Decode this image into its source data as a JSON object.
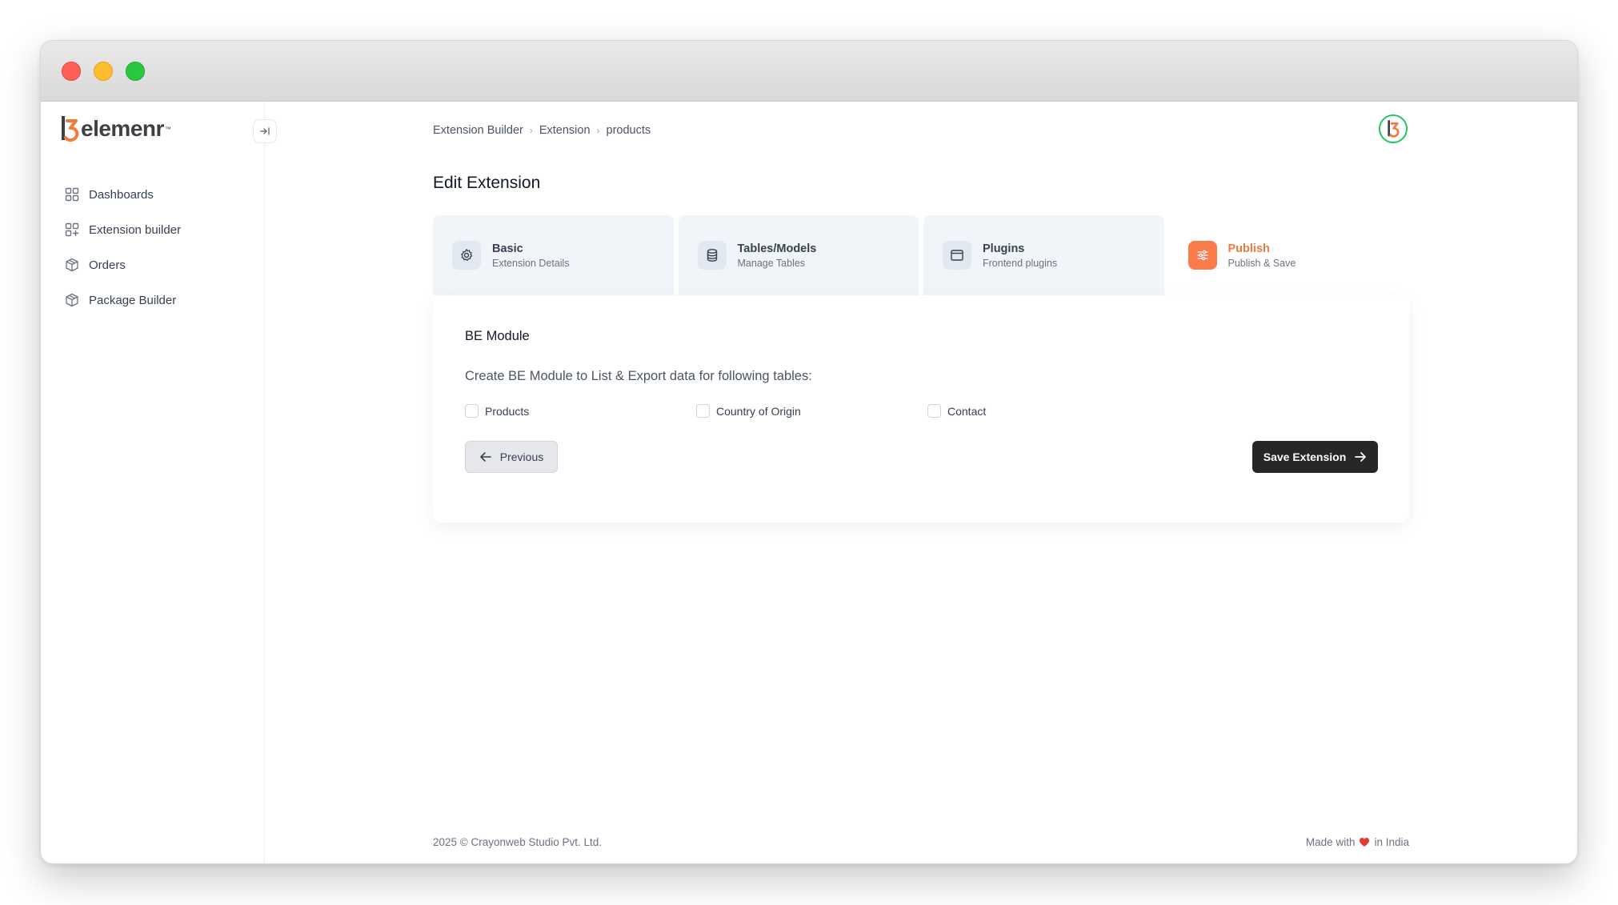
{
  "brand": {
    "name": "elemenr",
    "trademark": "™"
  },
  "sidebar": {
    "items": [
      {
        "label": "Dashboards",
        "icon": "grid-icon"
      },
      {
        "label": "Extension builder",
        "icon": "grid-plus-icon"
      },
      {
        "label": "Orders",
        "icon": "box-icon"
      },
      {
        "label": "Package Builder",
        "icon": "package-icon"
      }
    ]
  },
  "breadcrumb": [
    "Extension Builder",
    "Extension",
    "products"
  ],
  "page": {
    "title": "Edit Extension"
  },
  "steps": [
    {
      "title": "Basic",
      "subtitle": "Extension Details",
      "icon": "gear-icon",
      "active": false
    },
    {
      "title": "Tables/Models",
      "subtitle": "Manage Tables",
      "icon": "database-icon",
      "active": false
    },
    {
      "title": "Plugins",
      "subtitle": "Frontend plugins",
      "icon": "window-icon",
      "active": false
    },
    {
      "title": "Publish",
      "subtitle": "Publish & Save",
      "icon": "sliders-icon",
      "active": true
    }
  ],
  "module": {
    "title": "BE Module",
    "description": "Create BE Module to List & Export data for following tables:",
    "tables": [
      "Products",
      "Country of Origin",
      "Contact"
    ]
  },
  "buttons": {
    "previous": "Previous",
    "save": "Save Extension"
  },
  "footer": {
    "copyright": "2025 ©  Crayonweb Studio Pvt. Ltd.",
    "made_with": "Made with",
    "in_country": "in India"
  },
  "colors": {
    "accent": "#fb7c4a",
    "dark_button": "#27272a",
    "avatar_ring": "#22c55e"
  }
}
